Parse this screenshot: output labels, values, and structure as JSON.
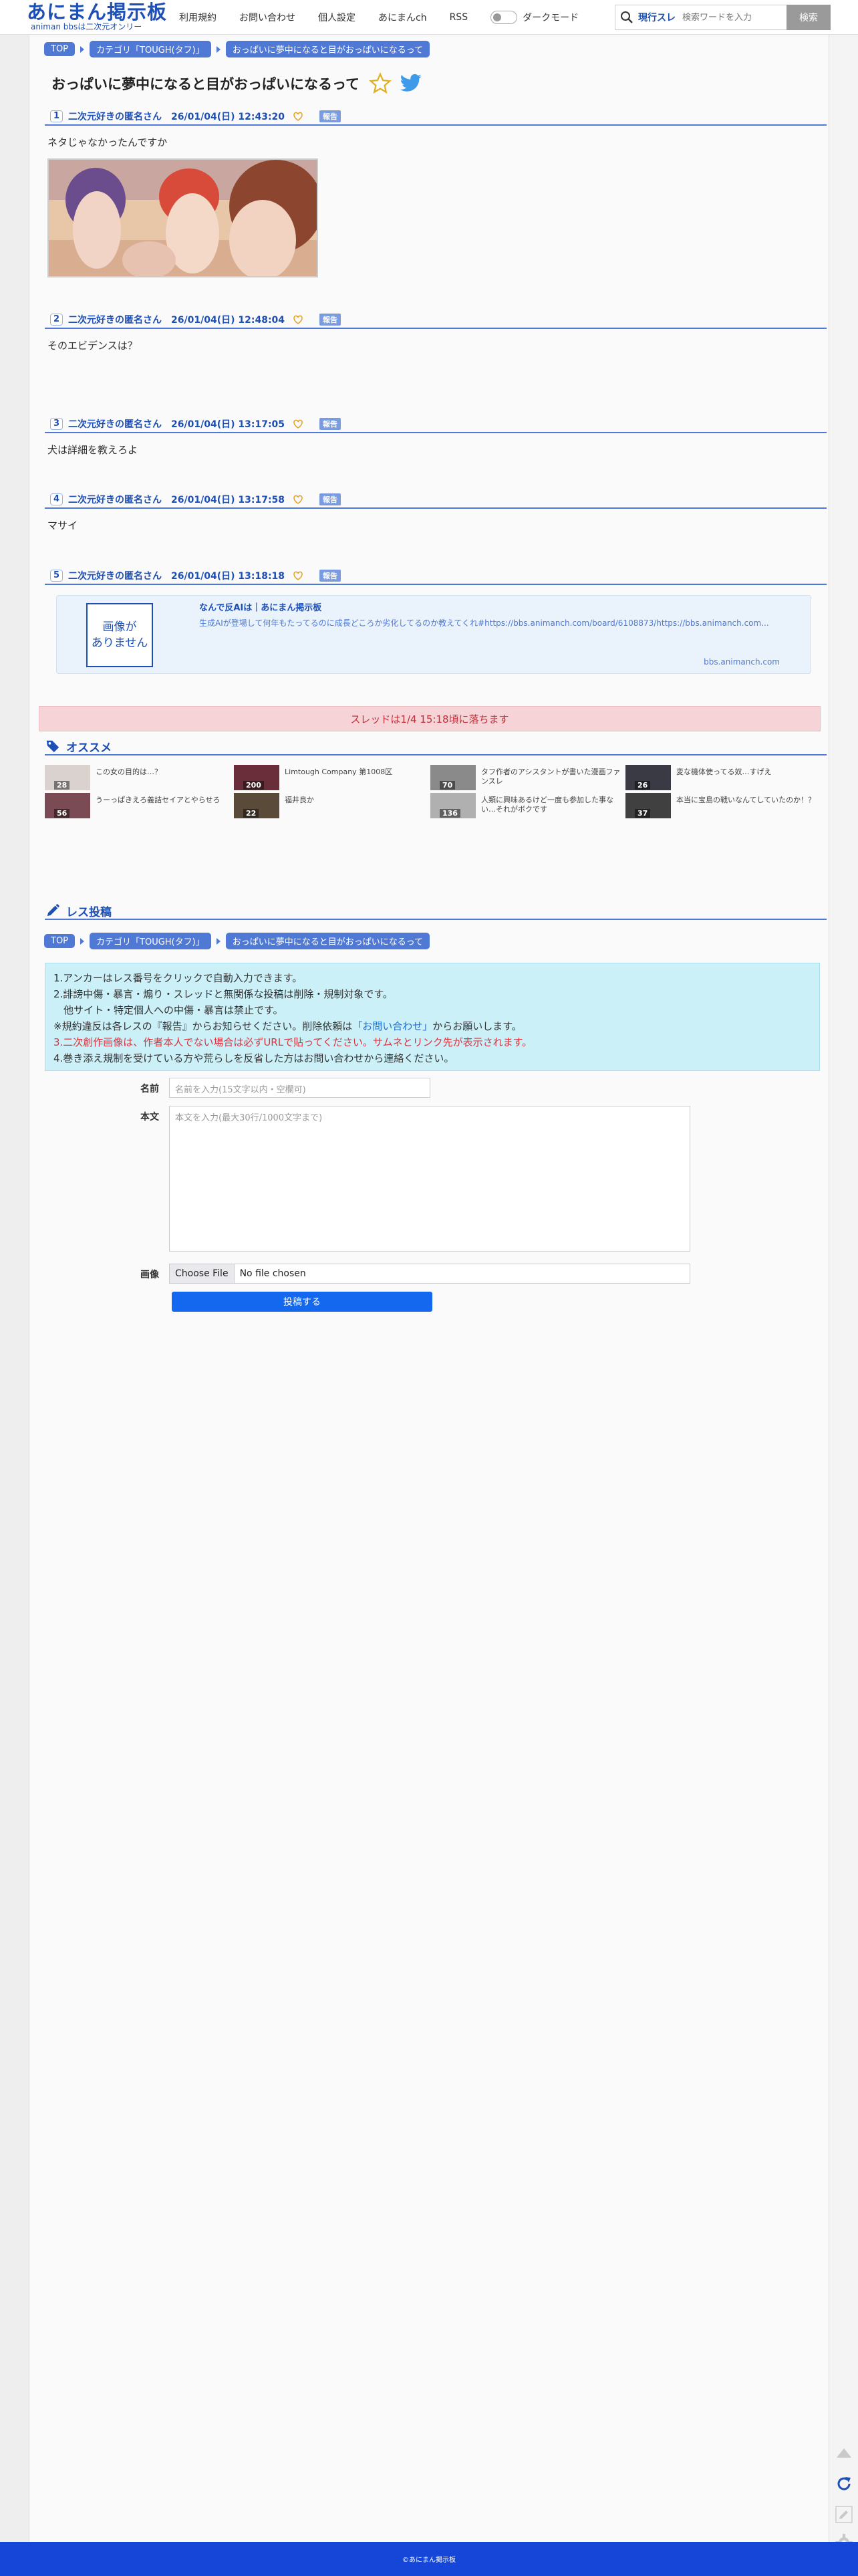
{
  "header": {
    "logo_main": "あにまん掲示板",
    "logo_sub": "animan bbsは二次元オンリー",
    "nav": [
      "利用規約",
      "お問い合わせ",
      "個人設定",
      "あにまんch",
      "RSS"
    ],
    "dark_mode_label": "ダークモード",
    "search_scope": "現行スレ",
    "search_placeholder": "検索ワードを入力",
    "search_button": "検索"
  },
  "breadcrumbs": [
    "TOP",
    "カテゴリ「TOUGH(タフ)」",
    "おっぱいに夢中になると目がおっぱいになるって"
  ],
  "thread_title": "おっぱいに夢中になると目がおっぱいになるって",
  "posts": [
    {
      "no": "1",
      "meta": "二次元好きの匿名さん　26/01/04(日) 12:43:20",
      "report": "報告",
      "body": "ネタじゃなかったんですか"
    },
    {
      "no": "2",
      "meta": "二次元好きの匿名さん　26/01/04(日) 12:48:04",
      "report": "報告",
      "body": "そのエビデンスは？"
    },
    {
      "no": "3",
      "meta": "二次元好きの匿名さん　26/01/04(日) 13:17:05",
      "report": "報告",
      "body": "犬は詳細を教えろよ"
    },
    {
      "no": "4",
      "meta": "二次元好きの匿名さん　26/01/04(日) 13:17:58",
      "report": "報告",
      "body": "マサイ"
    },
    {
      "no": "5",
      "meta": "二次元好きの匿名さん　26/01/04(日) 13:18:18",
      "report": "報告",
      "body": ""
    }
  ],
  "link_card": {
    "no_image": "画像が\nありません",
    "title": "なんで反AIは｜あにまん掲示板",
    "desc": "生成AIが登場して何年もたってるのに成長どころか劣化してるのか教えてくれ#https://bbs.animanch.com/board/6108873/https://bbs.animanch.com...",
    "domain": "bbs.animanch.com"
  },
  "expiry_notice": "スレッドは1/4 15:18頃に落ちます",
  "recommend": {
    "heading": "オススメ",
    "items": [
      {
        "title": "この女の目的は…？",
        "count": "28",
        "color": "#d9d2cf"
      },
      {
        "title": "Limtough Company 第1008区",
        "count": "200",
        "color": "#6a2e3a"
      },
      {
        "title": "タフ作者のアシスタントが書いた漫画ファンスレ",
        "count": "70",
        "color": "#8a8a8a"
      },
      {
        "title": "変な機体使ってる奴…すげえ",
        "count": "26",
        "color": "#3a3a45"
      },
      {
        "title": "うーっぱきえろ義詰セイアとやらせろ",
        "count": "56",
        "color": "#7a4a55"
      },
      {
        "title": "福井良か",
        "count": "22",
        "color": "#5a4a3a"
      },
      {
        "title": "人類に興味あるけど一度も参加した事ない…それがボクです",
        "count": "136",
        "color": "#b0b0b0"
      },
      {
        "title": "本当に宝島の戦いなんてしていたのか！？",
        "count": "37",
        "color": "#404040"
      }
    ]
  },
  "post_form": {
    "heading": "レス投稿",
    "rules": [
      "1.アンカーはレス番号をクリックで自動入力できます。",
      "2.誹謗中傷・暴言・煽り・スレッドと無関係な投稿は削除・規制対象です。",
      "　他サイト・特定個人への中傷・暴言は禁止です。",
      "※規約違反は各レスの『報告』からお知らせください。削除依頼は",
      "「お問い合わせ」",
      "からお願いします。",
      "3.二次創作画像は、作者本人でない場合は必ずURLで貼ってください。サムネとリンク先が表示されます。",
      "4.巻き添え規制を受けている方や荒らしを反省した方はお問い合わせから連絡ください。"
    ],
    "name_label": "名前",
    "name_placeholder": "名前を入力(15文字以内・空欄可)",
    "body_label": "本文",
    "body_placeholder": "本文を入力(最大30行/1000文字まで)",
    "image_label": "画像",
    "choose_file": "Choose File",
    "no_file": "No file chosen",
    "submit": "投稿する"
  },
  "footer": "©あにまん掲示板"
}
